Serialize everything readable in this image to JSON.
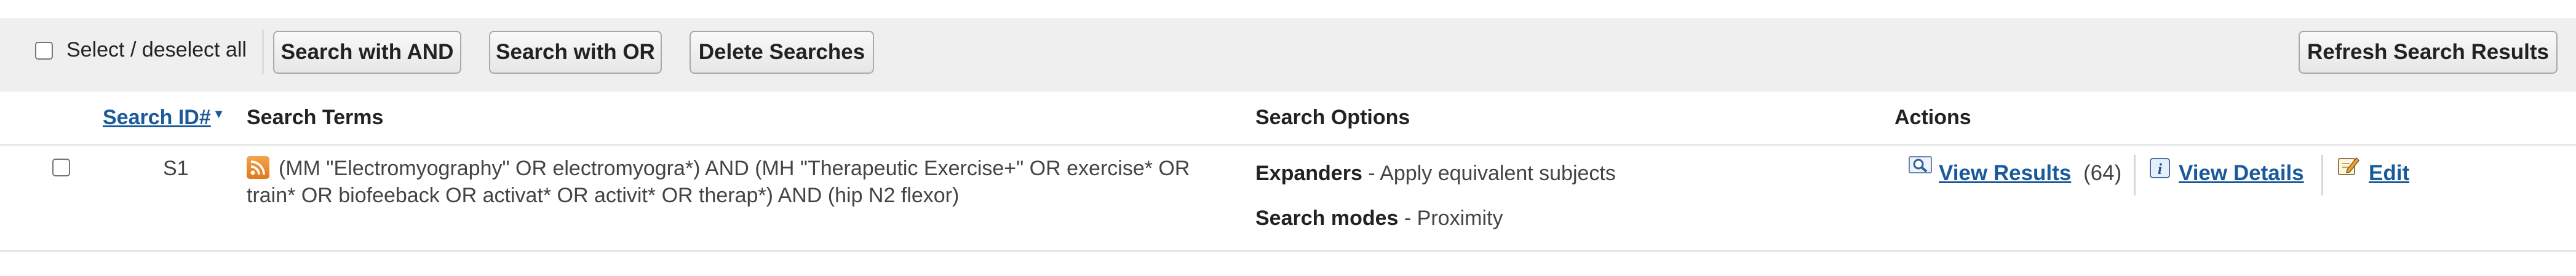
{
  "toolbar": {
    "select_all_label": "Select / deselect all",
    "btn_and": "Search with AND",
    "btn_or": "Search with OR",
    "btn_delete": "Delete Searches",
    "btn_refresh": "Refresh Search Results"
  },
  "table": {
    "headers": {
      "search_id": "Search ID#",
      "search_terms": "Search Terms",
      "search_options": "Search Options",
      "actions": "Actions"
    },
    "rows": [
      {
        "id": "S1",
        "terms": "(MM \"Electromyography\" OR electromyogra*) AND (MH \"Therapeutic Exercise+\" OR exercise* OR train* OR biofeeback OR activat* OR activit* OR therap*) AND (hip N2 flexor)",
        "expanders_label": "Expanders",
        "expanders_value": " - Apply equivalent subjects",
        "modes_label": "Search modes",
        "modes_value": " - Proximity",
        "view_results": "View Results",
        "result_count": "(64)",
        "view_details": "View Details",
        "edit": "Edit"
      }
    ]
  },
  "icons": {
    "rss": "rss-feed-icon",
    "magnifier": "view-results-icon",
    "info": "info-icon",
    "edit": "edit-icon"
  },
  "colors": {
    "link": "#1a5a9a",
    "toolbar_bg": "#efefef",
    "rss": "#e8862a"
  }
}
